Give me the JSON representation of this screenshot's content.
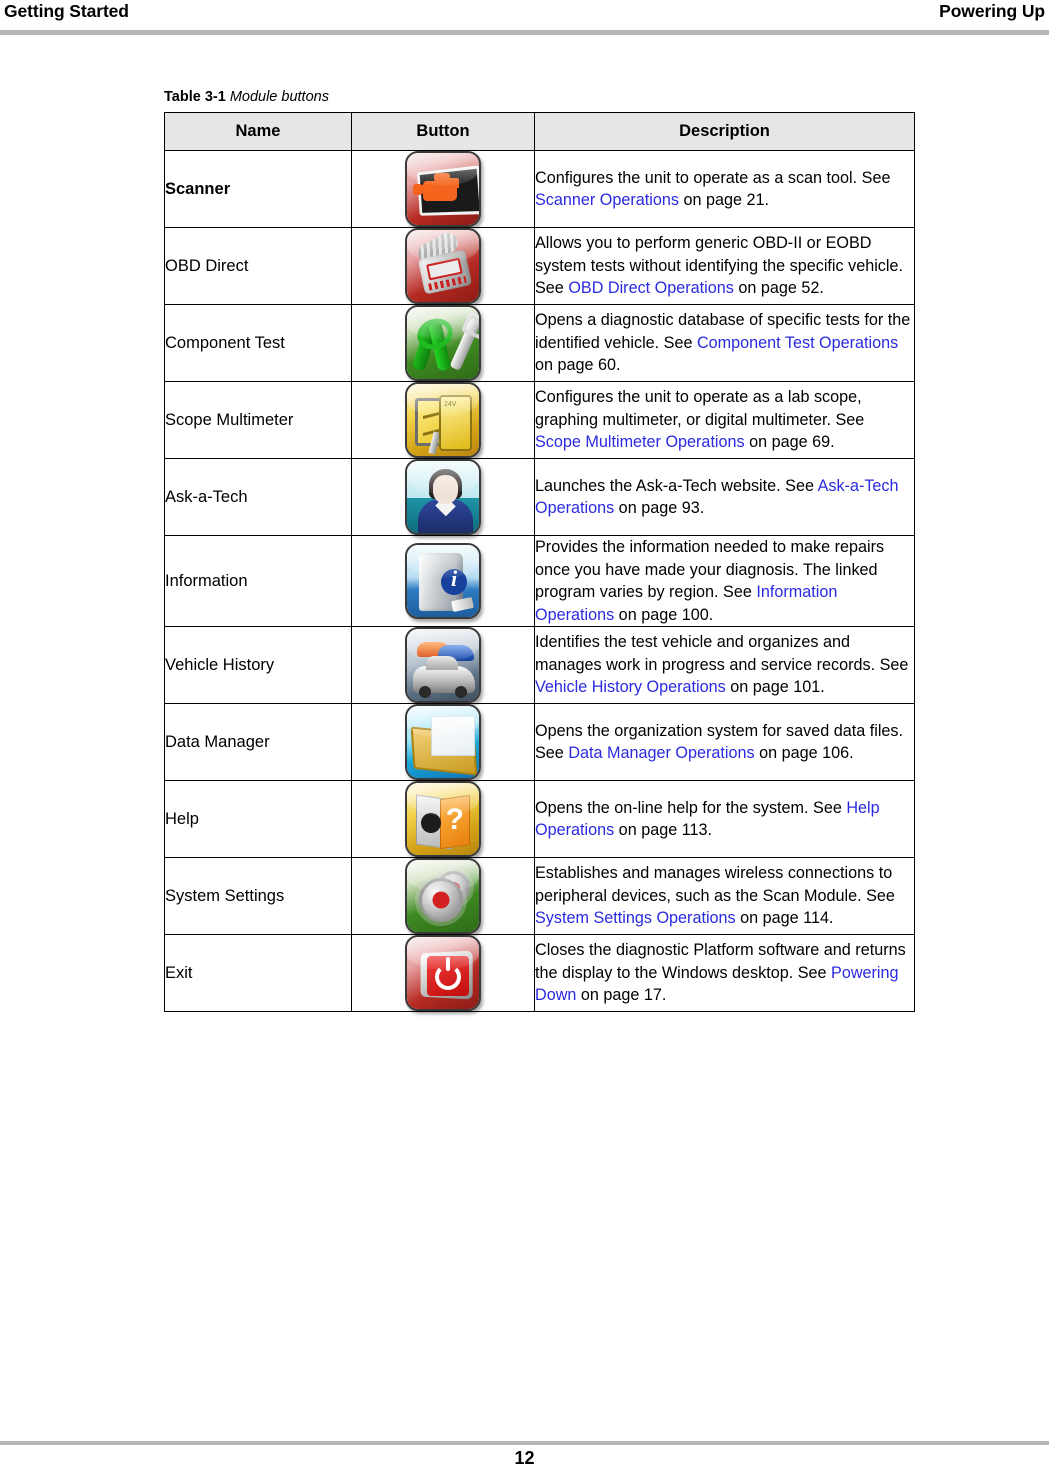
{
  "header": {
    "left": "Getting Started",
    "right": "Powering Up"
  },
  "footer": {
    "page_number": "12"
  },
  "table": {
    "caption_number": "Table 3-1",
    "caption_title": "Module buttons",
    "columns": [
      "Name",
      "Button",
      "Description"
    ],
    "rows": [
      {
        "name": "Scanner",
        "name_bold": true,
        "icon": "scanner-icon",
        "desc_parts": [
          {
            "text": "Configures the unit to operate as a scan tool. See ",
            "link": false
          },
          {
            "text": "Scanner Operations",
            "link": true
          },
          {
            "text": " on page 21.",
            "link": false
          }
        ]
      },
      {
        "name": "OBD Direct",
        "name_bold": false,
        "icon": "obd-direct-icon",
        "desc_parts": [
          {
            "text": "Allows you to perform generic OBD-II or EOBD system tests without identifying the specific vehicle. See ",
            "link": false
          },
          {
            "text": "OBD Direct Operations",
            "link": true
          },
          {
            "text": " on page 52.",
            "link": false
          }
        ]
      },
      {
        "name": "Component Test",
        "name_bold": false,
        "icon": "component-test-icon",
        "desc_parts": [
          {
            "text": "Opens a diagnostic database of specific tests for the identified vehicle. See ",
            "link": false
          },
          {
            "text": "Component Test Operations",
            "link": true
          },
          {
            "text": " on page 60.",
            "link": false
          }
        ]
      },
      {
        "name": "Scope Multimeter",
        "name_bold": false,
        "icon": "scope-multimeter-icon",
        "desc_parts": [
          {
            "text": "Configures the unit to operate as a lab scope, graphing multimeter, or digital multimeter. See ",
            "link": false
          },
          {
            "text": "Scope Multimeter Operations",
            "link": true
          },
          {
            "text": " on page 69.",
            "link": false
          }
        ]
      },
      {
        "name": "Ask-a-Tech",
        "name_bold": false,
        "icon": "ask-a-tech-icon",
        "desc_parts": [
          {
            "text": "Launches the Ask-a-Tech website. See ",
            "link": false
          },
          {
            "text": "Ask-a-Tech Operations",
            "link": true
          },
          {
            "text": " on page 93.",
            "link": false
          }
        ]
      },
      {
        "name": "Information",
        "name_bold": false,
        "icon": "information-icon",
        "desc_parts": [
          {
            "text": "Provides the information needed to make repairs once you have made your diagnosis. The linked program varies by region. See ",
            "link": false
          },
          {
            "text": "Information Operations",
            "link": true
          },
          {
            "text": " on page 100.",
            "link": false
          }
        ]
      },
      {
        "name": "Vehicle History",
        "name_bold": false,
        "icon": "vehicle-history-icon",
        "desc_parts": [
          {
            "text": "Identifies the test vehicle and organizes and manages work in progress and service records. See ",
            "link": false
          },
          {
            "text": "Vehicle History Operations",
            "link": true
          },
          {
            "text": " on page 101.",
            "link": false
          }
        ]
      },
      {
        "name": "Data Manager",
        "name_bold": false,
        "icon": "data-manager-icon",
        "desc_parts": [
          {
            "text": "Opens the organization system for saved data files. See ",
            "link": false
          },
          {
            "text": "Data Manager Operations",
            "link": true
          },
          {
            "text": " on page 106.",
            "link": false
          }
        ]
      },
      {
        "name": "Help",
        "name_bold": false,
        "icon": "help-icon",
        "desc_parts": [
          {
            "text": "Opens the on-line help for the system. See ",
            "link": false
          },
          {
            "text": "Help Operations",
            "link": true
          },
          {
            "text": " on page 113.",
            "link": false
          }
        ]
      },
      {
        "name": "System Settings",
        "name_bold": false,
        "icon": "system-settings-icon",
        "desc_parts": [
          {
            "text": "Establishes and manages wireless connections to peripheral devices, such as the Scan Module. See ",
            "link": false
          },
          {
            "text": "System Settings Operations",
            "link": true
          },
          {
            "text": " on page 114.",
            "link": false
          }
        ]
      },
      {
        "name": "Exit",
        "name_bold": false,
        "icon": "exit-icon",
        "desc_parts": [
          {
            "text": "Closes the diagnostic Platform software and returns the display to the Windows desktop. See ",
            "link": false
          },
          {
            "text": "Powering Down",
            "link": true
          },
          {
            "text": " on page 17.",
            "link": false
          }
        ]
      }
    ]
  },
  "colors": {
    "link": "#2a2ae0",
    "rule": "#b6b6b6",
    "header_fill": "#e6e6e6",
    "border": "#000000"
  }
}
